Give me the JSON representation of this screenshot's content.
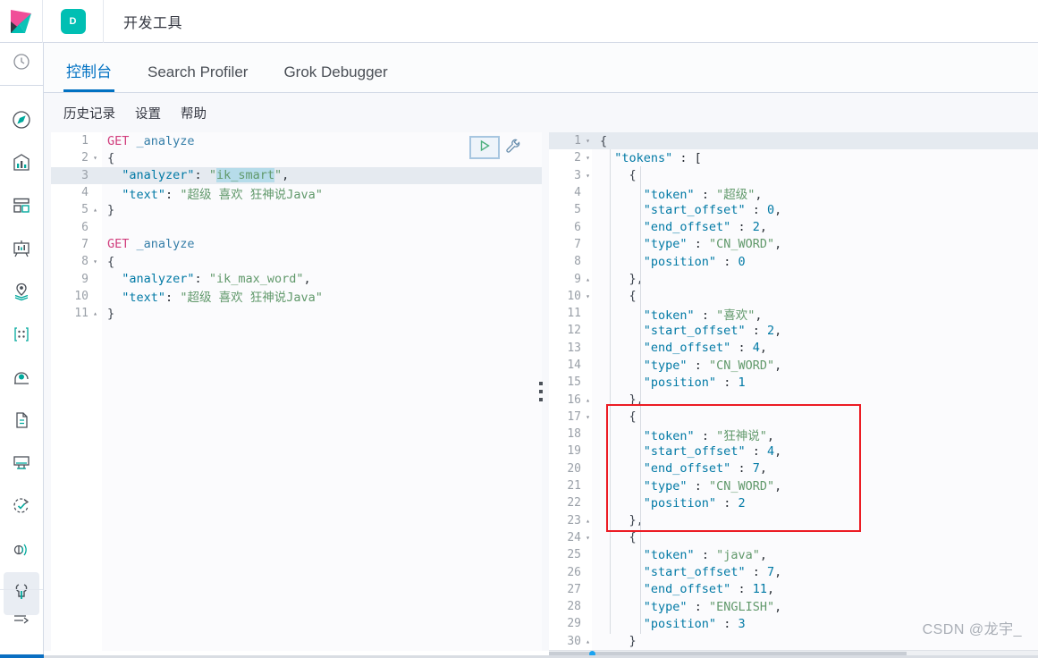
{
  "header": {
    "logo_name": "kibana-logo",
    "space_badge": "D",
    "app_title": "开发工具"
  },
  "colors": {
    "accent_blue": "#0071c2",
    "badge_teal": "#00bfb3",
    "annotation_red": "#ec1c24",
    "method_pink": "#d13c7c",
    "key_blue": "#0079a5",
    "string_green": "#61996b"
  },
  "sidebar": {
    "top_icon": "recently-viewed-clock-icon",
    "items": [
      {
        "icon": "compass-discover-icon",
        "label": "Discover"
      },
      {
        "icon": "bar-chart-visualize-icon",
        "label": "Visualize"
      },
      {
        "icon": "dashboard-grid-icon",
        "label": "Dashboard"
      },
      {
        "icon": "canvas-easel-icon",
        "label": "Canvas"
      },
      {
        "icon": "maps-pin-layers-icon",
        "label": "Maps"
      },
      {
        "icon": "machine-learning-icon",
        "label": "Machine Learning"
      },
      {
        "icon": "infrastructure-icon",
        "label": "Infrastructure"
      },
      {
        "icon": "logs-page-icon",
        "label": "Logs"
      },
      {
        "icon": "apm-monitor-icon",
        "label": "APM"
      },
      {
        "icon": "uptime-check-icon",
        "label": "Uptime"
      },
      {
        "icon": "siem-signal-icon",
        "label": "SIEM"
      },
      {
        "icon": "dev-tools-wrench-icon",
        "label": "Dev Tools",
        "active": true
      }
    ],
    "collapse_icon": "collapse-arrow-icon"
  },
  "tabs": [
    {
      "label": "控制台",
      "active": true
    },
    {
      "label": "Search Profiler",
      "active": false
    },
    {
      "label": "Grok Debugger",
      "active": false
    }
  ],
  "console_toolbar": {
    "links": [
      {
        "label": "历史记录",
        "name": "history-link"
      },
      {
        "label": "设置",
        "name": "settings-link"
      },
      {
        "label": "帮助",
        "name": "help-link"
      }
    ],
    "run_icon": "play-triangle-icon",
    "wrench_icon": "wrench-icon"
  },
  "request_editor": {
    "lines": [
      {
        "n": 1,
        "fold": "",
        "segments": [
          {
            "t": "GET ",
            "c": "k-method"
          },
          {
            "t": "_analyze",
            "c": "k-url"
          }
        ]
      },
      {
        "n": 2,
        "fold": "▾",
        "segments": [
          {
            "t": "{",
            "c": "k-brace"
          }
        ]
      },
      {
        "n": 3,
        "fold": "",
        "highlight": true,
        "segments": [
          {
            "t": "  ",
            "c": "k-punc"
          },
          {
            "t": "\"analyzer\"",
            "c": "k-key"
          },
          {
            "t": ": ",
            "c": "k-punc"
          },
          {
            "t": "\"",
            "c": "k-str"
          },
          {
            "t": "ik_smart",
            "c": "k-str sel"
          },
          {
            "t": "\"",
            "c": "k-str"
          },
          {
            "t": ",",
            "c": "k-punc"
          }
        ]
      },
      {
        "n": 4,
        "fold": "",
        "segments": [
          {
            "t": "  ",
            "c": "k-punc"
          },
          {
            "t": "\"text\"",
            "c": "k-key"
          },
          {
            "t": ": ",
            "c": "k-punc"
          },
          {
            "t": "\"超级 喜欢 狂神说Java\"",
            "c": "k-str"
          }
        ]
      },
      {
        "n": 5,
        "fold": "▴",
        "segments": [
          {
            "t": "}",
            "c": "k-brace"
          }
        ]
      },
      {
        "n": 6,
        "fold": "",
        "segments": [
          {
            "t": "",
            "c": "k-punc"
          }
        ]
      },
      {
        "n": 7,
        "fold": "",
        "segments": [
          {
            "t": "GET ",
            "c": "k-method"
          },
          {
            "t": "_analyze",
            "c": "k-url"
          }
        ]
      },
      {
        "n": 8,
        "fold": "▾",
        "segments": [
          {
            "t": "{",
            "c": "k-brace"
          }
        ]
      },
      {
        "n": 9,
        "fold": "",
        "segments": [
          {
            "t": "  ",
            "c": "k-punc"
          },
          {
            "t": "\"analyzer\"",
            "c": "k-key"
          },
          {
            "t": ": ",
            "c": "k-punc"
          },
          {
            "t": "\"ik_max_word\"",
            "c": "k-str"
          },
          {
            "t": ",",
            "c": "k-punc"
          }
        ]
      },
      {
        "n": 10,
        "fold": "",
        "segments": [
          {
            "t": "  ",
            "c": "k-punc"
          },
          {
            "t": "\"text\"",
            "c": "k-key"
          },
          {
            "t": ": ",
            "c": "k-punc"
          },
          {
            "t": "\"超级 喜欢 狂神说Java\"",
            "c": "k-str"
          }
        ]
      },
      {
        "n": 11,
        "fold": "▴",
        "segments": [
          {
            "t": "}",
            "c": "k-brace"
          }
        ]
      }
    ]
  },
  "response_editor": {
    "lines": [
      {
        "n": 1,
        "fold": "▾",
        "highlight": true,
        "segments": [
          {
            "t": "{",
            "c": "k-brace"
          }
        ]
      },
      {
        "n": 2,
        "fold": "▾",
        "segments": [
          {
            "t": "  ",
            "c": "k-punc"
          },
          {
            "t": "\"tokens\"",
            "c": "k-key"
          },
          {
            "t": " : [",
            "c": "k-punc"
          }
        ]
      },
      {
        "n": 3,
        "fold": "▾",
        "segments": [
          {
            "t": "    {",
            "c": "k-brace"
          }
        ]
      },
      {
        "n": 4,
        "fold": "",
        "segments": [
          {
            "t": "      ",
            "c": "k-punc"
          },
          {
            "t": "\"token\"",
            "c": "k-key"
          },
          {
            "t": " : ",
            "c": "k-punc"
          },
          {
            "t": "\"超级\"",
            "c": "k-str"
          },
          {
            "t": ",",
            "c": "k-punc"
          }
        ]
      },
      {
        "n": 5,
        "fold": "",
        "segments": [
          {
            "t": "      ",
            "c": "k-punc"
          },
          {
            "t": "\"start_offset\"",
            "c": "k-key"
          },
          {
            "t": " : ",
            "c": "k-punc"
          },
          {
            "t": "0",
            "c": "k-num"
          },
          {
            "t": ",",
            "c": "k-punc"
          }
        ]
      },
      {
        "n": 6,
        "fold": "",
        "segments": [
          {
            "t": "      ",
            "c": "k-punc"
          },
          {
            "t": "\"end_offset\"",
            "c": "k-key"
          },
          {
            "t": " : ",
            "c": "k-punc"
          },
          {
            "t": "2",
            "c": "k-num"
          },
          {
            "t": ",",
            "c": "k-punc"
          }
        ]
      },
      {
        "n": 7,
        "fold": "",
        "segments": [
          {
            "t": "      ",
            "c": "k-punc"
          },
          {
            "t": "\"type\"",
            "c": "k-key"
          },
          {
            "t": " : ",
            "c": "k-punc"
          },
          {
            "t": "\"CN_WORD\"",
            "c": "k-str"
          },
          {
            "t": ",",
            "c": "k-punc"
          }
        ]
      },
      {
        "n": 8,
        "fold": "",
        "segments": [
          {
            "t": "      ",
            "c": "k-punc"
          },
          {
            "t": "\"position\"",
            "c": "k-key"
          },
          {
            "t": " : ",
            "c": "k-punc"
          },
          {
            "t": "0",
            "c": "k-num"
          }
        ]
      },
      {
        "n": 9,
        "fold": "▴",
        "segments": [
          {
            "t": "    },",
            "c": "k-brace"
          }
        ]
      },
      {
        "n": 10,
        "fold": "▾",
        "segments": [
          {
            "t": "    {",
            "c": "k-brace"
          }
        ]
      },
      {
        "n": 11,
        "fold": "",
        "segments": [
          {
            "t": "      ",
            "c": "k-punc"
          },
          {
            "t": "\"token\"",
            "c": "k-key"
          },
          {
            "t": " : ",
            "c": "k-punc"
          },
          {
            "t": "\"喜欢\"",
            "c": "k-str"
          },
          {
            "t": ",",
            "c": "k-punc"
          }
        ]
      },
      {
        "n": 12,
        "fold": "",
        "segments": [
          {
            "t": "      ",
            "c": "k-punc"
          },
          {
            "t": "\"start_offset\"",
            "c": "k-key"
          },
          {
            "t": " : ",
            "c": "k-punc"
          },
          {
            "t": "2",
            "c": "k-num"
          },
          {
            "t": ",",
            "c": "k-punc"
          }
        ]
      },
      {
        "n": 13,
        "fold": "",
        "segments": [
          {
            "t": "      ",
            "c": "k-punc"
          },
          {
            "t": "\"end_offset\"",
            "c": "k-key"
          },
          {
            "t": " : ",
            "c": "k-punc"
          },
          {
            "t": "4",
            "c": "k-num"
          },
          {
            "t": ",",
            "c": "k-punc"
          }
        ]
      },
      {
        "n": 14,
        "fold": "",
        "segments": [
          {
            "t": "      ",
            "c": "k-punc"
          },
          {
            "t": "\"type\"",
            "c": "k-key"
          },
          {
            "t": " : ",
            "c": "k-punc"
          },
          {
            "t": "\"CN_WORD\"",
            "c": "k-str"
          },
          {
            "t": ",",
            "c": "k-punc"
          }
        ]
      },
      {
        "n": 15,
        "fold": "",
        "segments": [
          {
            "t": "      ",
            "c": "k-punc"
          },
          {
            "t": "\"position\"",
            "c": "k-key"
          },
          {
            "t": " : ",
            "c": "k-punc"
          },
          {
            "t": "1",
            "c": "k-num"
          }
        ]
      },
      {
        "n": 16,
        "fold": "▴",
        "segments": [
          {
            "t": "    },",
            "c": "k-brace"
          }
        ]
      },
      {
        "n": 17,
        "fold": "▾",
        "segments": [
          {
            "t": "    {",
            "c": "k-brace"
          }
        ]
      },
      {
        "n": 18,
        "fold": "",
        "segments": [
          {
            "t": "      ",
            "c": "k-punc"
          },
          {
            "t": "\"token\"",
            "c": "k-key"
          },
          {
            "t": " : ",
            "c": "k-punc"
          },
          {
            "t": "\"狂神说\"",
            "c": "k-str"
          },
          {
            "t": ",",
            "c": "k-punc"
          }
        ]
      },
      {
        "n": 19,
        "fold": "",
        "segments": [
          {
            "t": "      ",
            "c": "k-punc"
          },
          {
            "t": "\"start_offset\"",
            "c": "k-key"
          },
          {
            "t": " : ",
            "c": "k-punc"
          },
          {
            "t": "4",
            "c": "k-num"
          },
          {
            "t": ",",
            "c": "k-punc"
          }
        ]
      },
      {
        "n": 20,
        "fold": "",
        "segments": [
          {
            "t": "      ",
            "c": "k-punc"
          },
          {
            "t": "\"end_offset\"",
            "c": "k-key"
          },
          {
            "t": " : ",
            "c": "k-punc"
          },
          {
            "t": "7",
            "c": "k-num"
          },
          {
            "t": ",",
            "c": "k-punc"
          }
        ]
      },
      {
        "n": 21,
        "fold": "",
        "segments": [
          {
            "t": "      ",
            "c": "k-punc"
          },
          {
            "t": "\"type\"",
            "c": "k-key"
          },
          {
            "t": " : ",
            "c": "k-punc"
          },
          {
            "t": "\"CN_WORD\"",
            "c": "k-str"
          },
          {
            "t": ",",
            "c": "k-punc"
          }
        ]
      },
      {
        "n": 22,
        "fold": "",
        "segments": [
          {
            "t": "      ",
            "c": "k-punc"
          },
          {
            "t": "\"position\"",
            "c": "k-key"
          },
          {
            "t": " : ",
            "c": "k-punc"
          },
          {
            "t": "2",
            "c": "k-num"
          }
        ]
      },
      {
        "n": 23,
        "fold": "▴",
        "segments": [
          {
            "t": "    },",
            "c": "k-brace"
          }
        ]
      },
      {
        "n": 24,
        "fold": "▾",
        "segments": [
          {
            "t": "    {",
            "c": "k-brace"
          }
        ]
      },
      {
        "n": 25,
        "fold": "",
        "segments": [
          {
            "t": "      ",
            "c": "k-punc"
          },
          {
            "t": "\"token\"",
            "c": "k-key"
          },
          {
            "t": " : ",
            "c": "k-punc"
          },
          {
            "t": "\"java\"",
            "c": "k-str"
          },
          {
            "t": ",",
            "c": "k-punc"
          }
        ]
      },
      {
        "n": 26,
        "fold": "",
        "segments": [
          {
            "t": "      ",
            "c": "k-punc"
          },
          {
            "t": "\"start_offset\"",
            "c": "k-key"
          },
          {
            "t": " : ",
            "c": "k-punc"
          },
          {
            "t": "7",
            "c": "k-num"
          },
          {
            "t": ",",
            "c": "k-punc"
          }
        ]
      },
      {
        "n": 27,
        "fold": "",
        "segments": [
          {
            "t": "      ",
            "c": "k-punc"
          },
          {
            "t": "\"end_offset\"",
            "c": "k-key"
          },
          {
            "t": " : ",
            "c": "k-punc"
          },
          {
            "t": "11",
            "c": "k-num"
          },
          {
            "t": ",",
            "c": "k-punc"
          }
        ]
      },
      {
        "n": 28,
        "fold": "",
        "segments": [
          {
            "t": "      ",
            "c": "k-punc"
          },
          {
            "t": "\"type\"",
            "c": "k-key"
          },
          {
            "t": " : ",
            "c": "k-punc"
          },
          {
            "t": "\"ENGLISH\"",
            "c": "k-str"
          },
          {
            "t": ",",
            "c": "k-punc"
          }
        ]
      },
      {
        "n": 29,
        "fold": "",
        "segments": [
          {
            "t": "      ",
            "c": "k-punc"
          },
          {
            "t": "\"position\"",
            "c": "k-key"
          },
          {
            "t": " : ",
            "c": "k-punc"
          },
          {
            "t": "3",
            "c": "k-num"
          }
        ]
      },
      {
        "n": 30,
        "fold": "▴",
        "segments": [
          {
            "t": "    }",
            "c": "k-brace"
          }
        ]
      }
    ]
  },
  "annotation": {
    "name": "red-highlight-box",
    "covers_lines": "17-23"
  },
  "splitter": {
    "name": "pane-splitter",
    "icon": "grab-dots-icon"
  },
  "watermark": {
    "text": "CSDN @龙宇_"
  }
}
